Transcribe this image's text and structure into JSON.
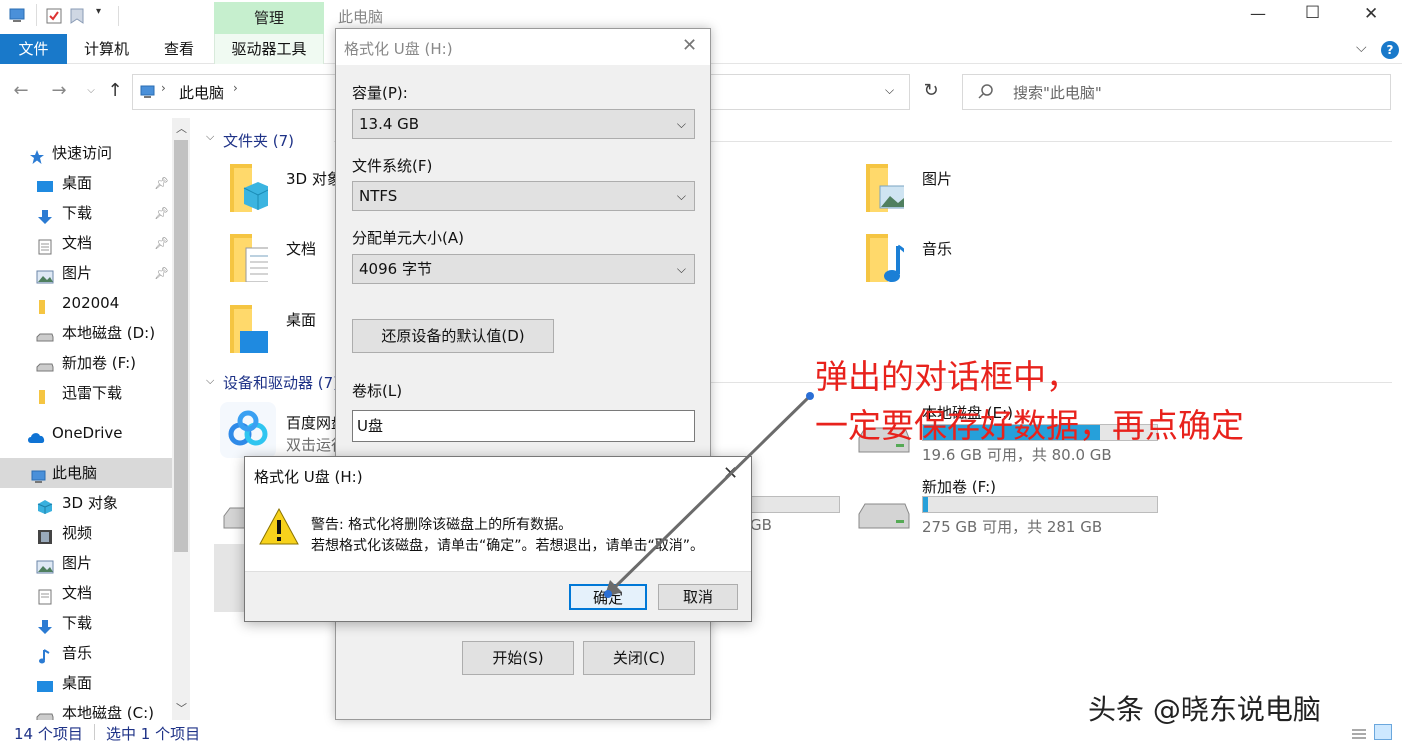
{
  "window": {
    "title": "此电脑",
    "controls": [
      "—",
      "☐",
      "✕"
    ]
  },
  "ribbon": {
    "context_header": "管理",
    "tabs": [
      "文件",
      "计算机",
      "查看",
      "驱动器工具"
    ]
  },
  "address": {
    "path": "此电脑",
    "search_placeholder": "搜索\"此电脑\""
  },
  "sidebar": {
    "quick_access": "快速访问",
    "pinned": [
      {
        "label": "桌面",
        "icon": "desktop-icon"
      },
      {
        "label": "下载",
        "icon": "download-icon"
      },
      {
        "label": "文档",
        "icon": "document-icon"
      },
      {
        "label": "图片",
        "icon": "picture-icon"
      }
    ],
    "recent": [
      {
        "label": "202004",
        "icon": "folder-icon"
      },
      {
        "label": "本地磁盘 (D:)",
        "icon": "drive-icon"
      },
      {
        "label": "新加卷 (F:)",
        "icon": "drive-icon"
      },
      {
        "label": "迅雷下载",
        "icon": "folder-icon"
      }
    ],
    "onedrive": "OneDrive",
    "this_pc": "此电脑",
    "pc_items": [
      {
        "label": "3D 对象",
        "icon": "cube-icon"
      },
      {
        "label": "视频",
        "icon": "video-icon"
      },
      {
        "label": "图片",
        "icon": "picture-icon"
      },
      {
        "label": "文档",
        "icon": "document-icon"
      },
      {
        "label": "下载",
        "icon": "download-icon"
      },
      {
        "label": "音乐",
        "icon": "music-icon"
      },
      {
        "label": "桌面",
        "icon": "desktop-icon"
      },
      {
        "label": "本地磁盘 (C:)",
        "icon": "drive-icon"
      }
    ]
  },
  "main": {
    "folders_header": "文件夹 (7)",
    "folders": [
      {
        "label": "3D 对象"
      },
      {
        "label": "图片"
      },
      {
        "label": "文档"
      },
      {
        "label": "音乐"
      },
      {
        "label": "桌面"
      }
    ],
    "devices_header": "设备和驱动器 (7)",
    "baidu": {
      "name": "百度网盘",
      "sub": "双击运行"
    },
    "drive_local": {
      "name": "本地磁盘 (E:)",
      "free": "19.6 GB 可用，共 80.0 GB",
      "used_fraction": 0.755
    },
    "drive_new": {
      "name": "新加卷 (F:)",
      "free": "275 GB 可用，共 281 GB",
      "used_fraction": 0.02
    },
    "partial_gb": "GB"
  },
  "status": {
    "count": "14 个项目",
    "selected": "选中 1 个项目"
  },
  "format_dialog": {
    "title": "格式化 U盘 (H:)",
    "capacity_label": "容量(P):",
    "capacity_value": "13.4 GB",
    "fs_label": "文件系统(F)",
    "fs_value": "NTFS",
    "alloc_label": "分配单元大小(A)",
    "alloc_value": "4096 字节",
    "restore_button": "还原设备的默认值(D)",
    "volume_label": "卷标(L)",
    "volume_value": "U盘",
    "start_button": "开始(S)",
    "close_button": "关闭(C)"
  },
  "warning_dialog": {
    "title": "格式化 U盘 (H:)",
    "line1": "警告: 格式化将删除该磁盘上的所有数据。",
    "line2": "若想格式化该磁盘，请单击“确定”。若想退出，请单击“取消”。",
    "ok_button": "确定",
    "cancel_button": "取消"
  },
  "annotation": {
    "line1": "弹出的对话框中，",
    "line2": "一定要保存好数据，再点确定",
    "color": "#e8221c"
  },
  "watermark": "头条 @晓东说电脑"
}
